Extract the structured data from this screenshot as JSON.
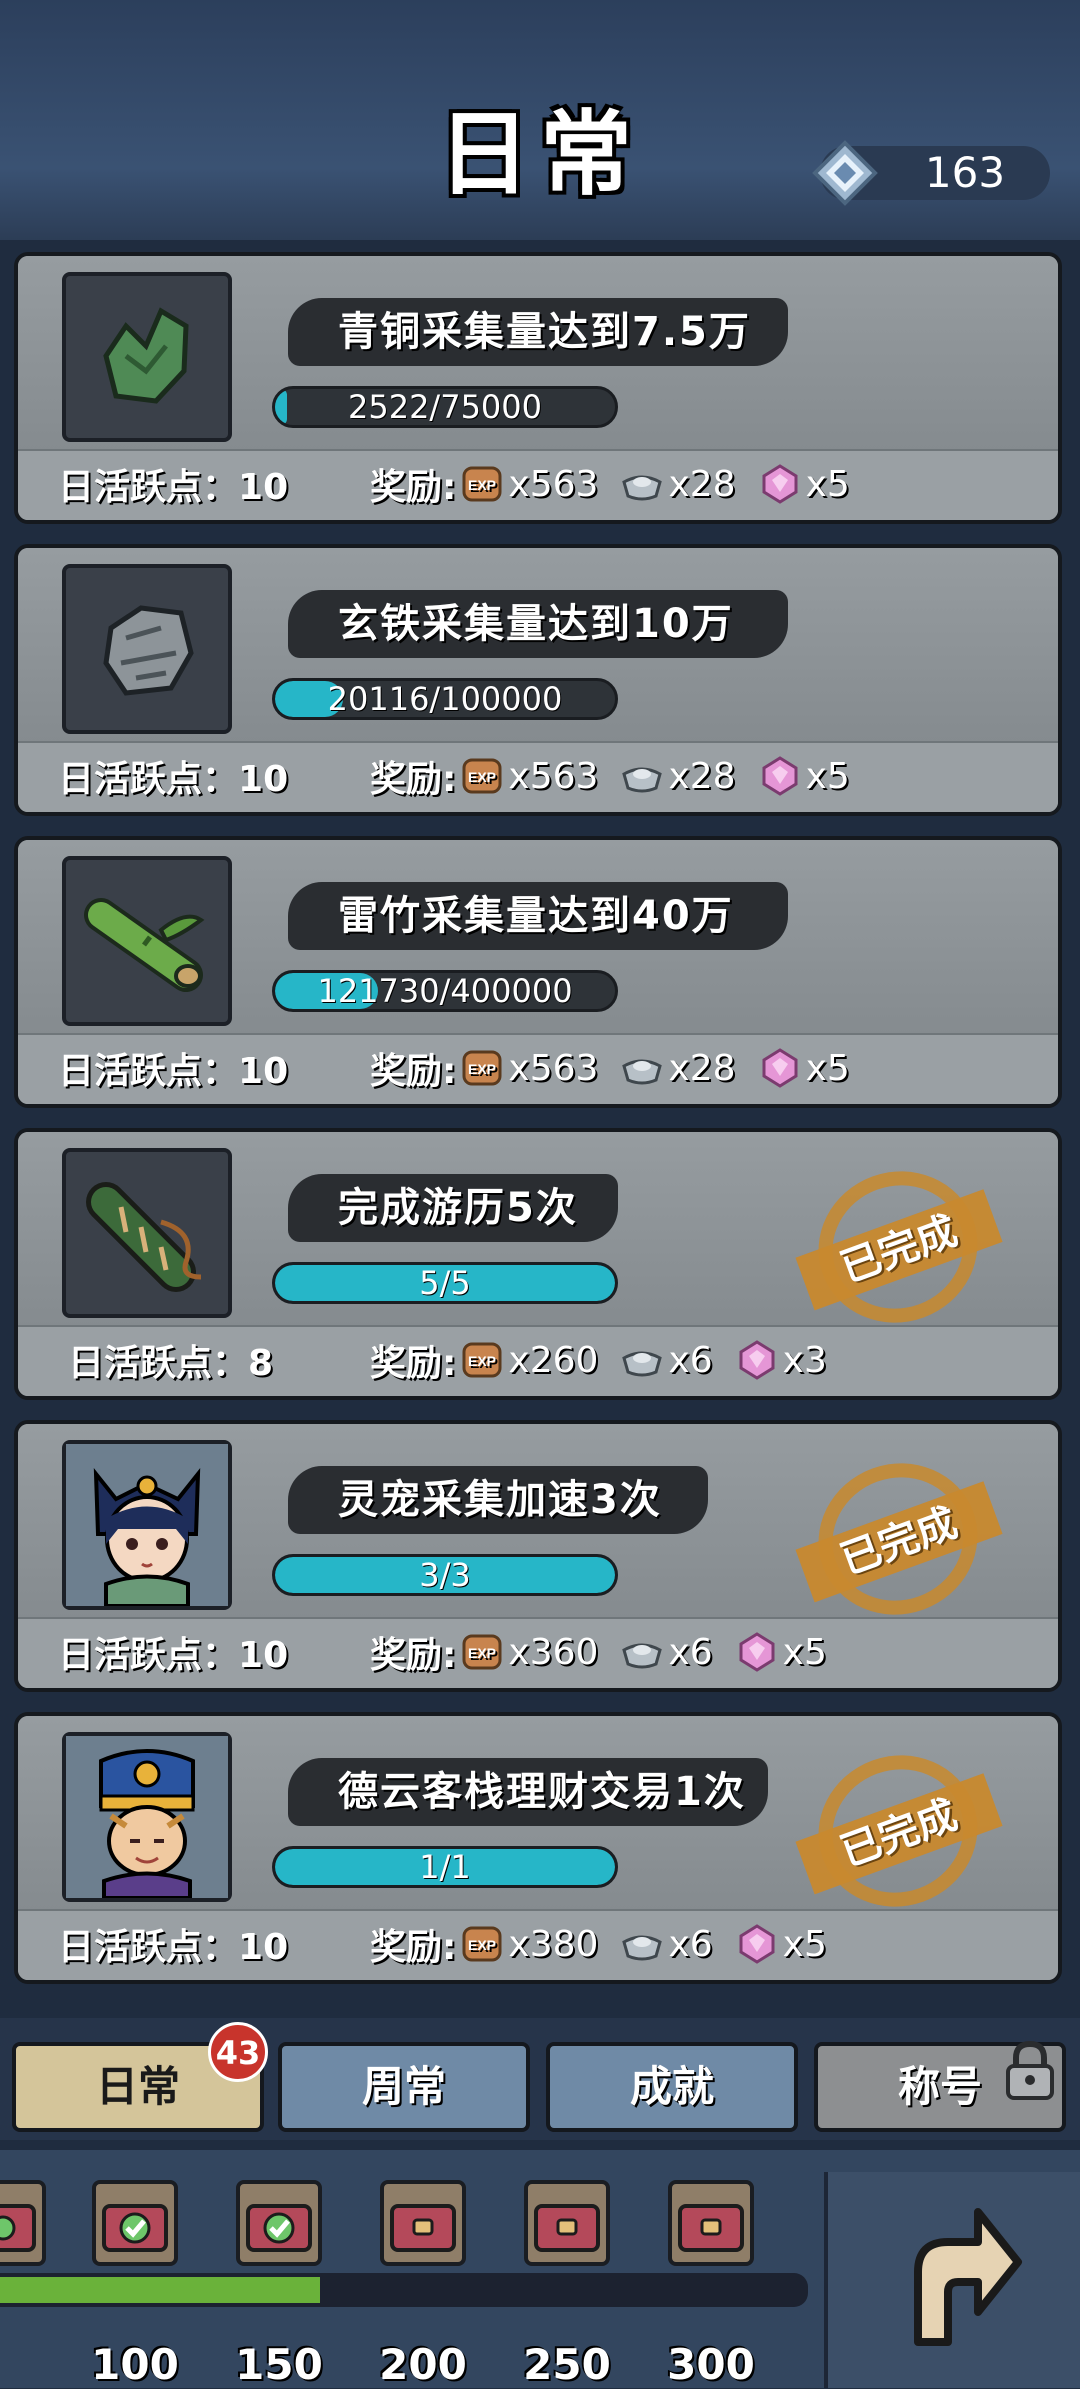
{
  "header": {
    "title": "日常",
    "currency": {
      "icon": "gem-icon",
      "value": "163"
    }
  },
  "tasks": [
    {
      "icon": "bronze-ore-icon",
      "title": "青铜采集量达到7.5万",
      "progress_text": "2522/75000",
      "progress": 0.034,
      "activity_label": "日活跃点：",
      "activity_value": "10",
      "reward_label": "奖励:",
      "rewards": [
        "x563",
        "x28",
        "x5"
      ],
      "completed": false
    },
    {
      "icon": "iron-ore-icon",
      "title": "玄铁采集量达到10万",
      "progress_text": "20116/100000",
      "progress": 0.201,
      "activity_label": "日活跃点：",
      "activity_value": "10",
      "reward_label": "奖励:",
      "rewards": [
        "x563",
        "x28",
        "x5"
      ],
      "completed": false
    },
    {
      "icon": "bamboo-icon",
      "title": "雷竹采集量达到40万",
      "progress_text": "121730/400000",
      "progress": 0.304,
      "activity_label": "日活跃点：",
      "activity_value": "10",
      "reward_label": "奖励:",
      "rewards": [
        "x563",
        "x28",
        "x5"
      ],
      "completed": false
    },
    {
      "icon": "scroll-icon",
      "title": "完成游历5次",
      "progress_text": "5/5",
      "progress": 1.0,
      "activity_label": "日活跃点：",
      "activity_value": "8",
      "reward_label": "奖励:",
      "rewards": [
        "x260",
        "x6",
        "x3"
      ],
      "completed": true,
      "completed_label": "已完成"
    },
    {
      "icon": "pet-avatar-icon",
      "title": "灵宠采集加速3次",
      "progress_text": "3/3",
      "progress": 1.0,
      "activity_label": "日活跃点：",
      "activity_value": "10",
      "reward_label": "奖励:",
      "rewards": [
        "x360",
        "x6",
        "x5"
      ],
      "completed": true,
      "completed_label": "已完成"
    },
    {
      "icon": "merchant-avatar-icon",
      "title": "德云客栈理财交易1次",
      "progress_text": "1/1",
      "progress": 1.0,
      "activity_label": "日活跃点：",
      "activity_value": "10",
      "reward_label": "奖励:",
      "rewards": [
        "x380",
        "x6",
        "x5"
      ],
      "completed": true,
      "completed_label": "已完成"
    }
  ],
  "reward_icons": [
    "exp-icon",
    "silver-ingot-icon",
    "pink-gem-icon"
  ],
  "tabs": [
    {
      "label": "日常",
      "badge": "43",
      "active": true
    },
    {
      "label": "周常"
    },
    {
      "label": "成就"
    },
    {
      "label": "称号",
      "locked": true
    }
  ],
  "milestones": {
    "values": [
      "100",
      "150",
      "200",
      "250",
      "300"
    ],
    "progress": 0.4
  },
  "colors": {
    "accent": "#26b6c8",
    "stamp": "#c8892e",
    "badge": "#c8342c",
    "progress_green": "#6ab23a"
  }
}
